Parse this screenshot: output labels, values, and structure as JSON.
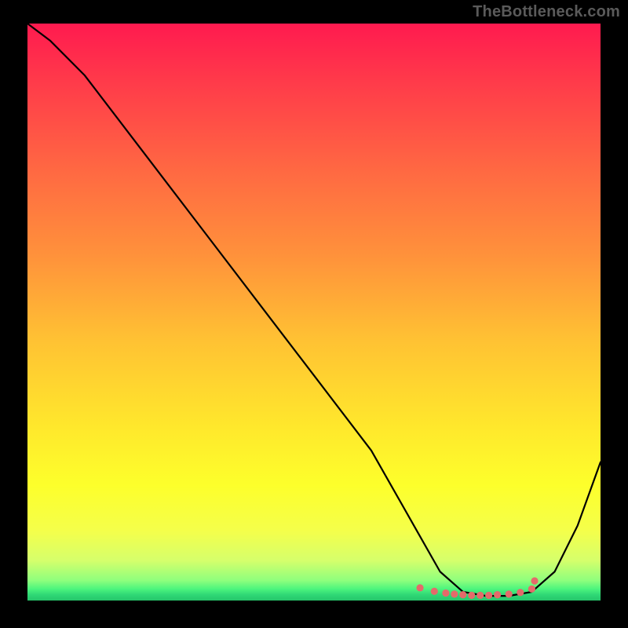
{
  "watermark": "TheBottleneck.com",
  "chart_data": {
    "type": "line",
    "title": "",
    "xlabel": "",
    "ylabel": "",
    "xlim": [
      0,
      100
    ],
    "ylim": [
      0,
      100
    ],
    "series": [
      {
        "name": "curve",
        "x": [
          0,
          4,
          10,
          20,
          30,
          40,
          50,
          60,
          68,
          72,
          76,
          80,
          84,
          88,
          92,
          96,
          100
        ],
        "y": [
          100,
          97,
          91,
          78,
          65,
          52,
          39,
          26,
          12,
          5,
          1.5,
          0.8,
          0.8,
          1.5,
          5,
          13,
          24
        ]
      }
    ],
    "markers": {
      "name": "optimum-range-dots",
      "color": "#e46a6a",
      "x": [
        68.5,
        71,
        73,
        74.5,
        76,
        77.5,
        79,
        80.5,
        82,
        84,
        86,
        88,
        88.5
      ],
      "y": [
        2.2,
        1.6,
        1.3,
        1.1,
        1.0,
        0.9,
        0.9,
        0.9,
        1.0,
        1.1,
        1.4,
        2.0,
        3.4
      ]
    },
    "gradient_stops": [
      {
        "pct": 0,
        "color": "#ff1a4f"
      },
      {
        "pct": 10,
        "color": "#ff3a4a"
      },
      {
        "pct": 26,
        "color": "#ff6a42"
      },
      {
        "pct": 40,
        "color": "#ff913b"
      },
      {
        "pct": 55,
        "color": "#ffc233"
      },
      {
        "pct": 70,
        "color": "#ffe82c"
      },
      {
        "pct": 80,
        "color": "#fdff2b"
      },
      {
        "pct": 88,
        "color": "#f4ff4b"
      },
      {
        "pct": 93,
        "color": "#d6ff6b"
      },
      {
        "pct": 96.5,
        "color": "#8fff7d"
      },
      {
        "pct": 98,
        "color": "#4cf57d"
      },
      {
        "pct": 99,
        "color": "#2fd876"
      },
      {
        "pct": 100,
        "color": "#26c56a"
      }
    ]
  }
}
